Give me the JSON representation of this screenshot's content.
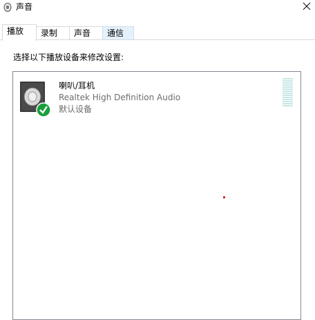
{
  "window": {
    "title": "声音"
  },
  "tabs": [
    {
      "label": "播放",
      "active": true
    },
    {
      "label": "录制"
    },
    {
      "label": "声音"
    },
    {
      "label": "通信",
      "hover": true
    }
  ],
  "instruction": "选择以下播放设备来修改设置:",
  "devices": [
    {
      "name": "喇叭/耳机",
      "driver": "Realtek High Definition Audio",
      "status": "默认设备",
      "icon": "speaker-icon",
      "badge": "default-check-icon",
      "meter_level": 0
    }
  ],
  "colors": {
    "check_green": "#1a9f3d",
    "meter": "#c6e8e6",
    "tab_hover": "#e5f1fb"
  }
}
